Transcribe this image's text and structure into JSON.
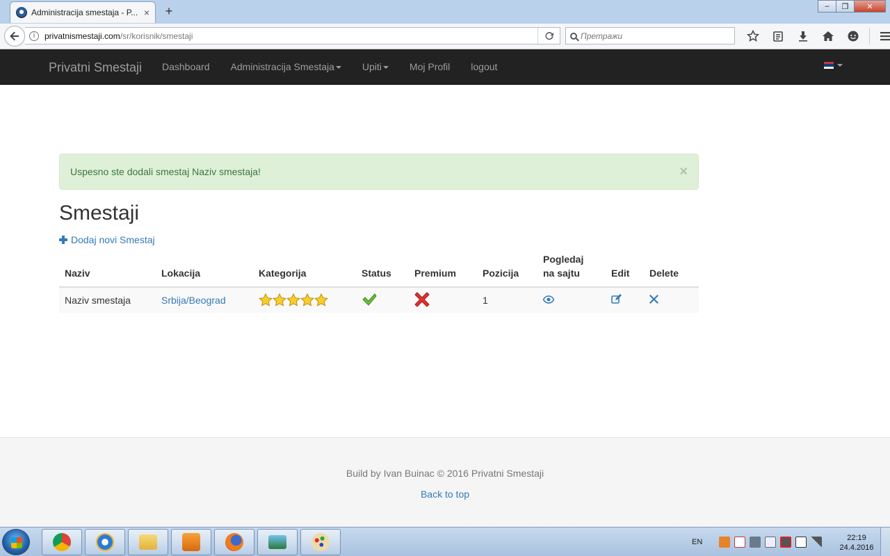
{
  "browser": {
    "tab_title": "Administracija smestaja - P...",
    "tab_close": "×",
    "new_tab": "+",
    "url_host": "privatnismestaji.com",
    "url_path": "/sr/korisnik/smestaji",
    "search_placeholder": "Претражи",
    "window_controls": {
      "minimize": "–",
      "maximize": "❐",
      "close": "✕"
    }
  },
  "site_nav": {
    "brand": "Privatni Smestaji",
    "links": [
      {
        "label": "Dashboard",
        "dropdown": false
      },
      {
        "label": "Administracija Smestaja",
        "dropdown": true
      },
      {
        "label": "Upiti",
        "dropdown": true
      },
      {
        "label": "Moj Profil",
        "dropdown": false
      },
      {
        "label": "logout",
        "dropdown": false
      }
    ],
    "flag_colors": [
      "#c6363c",
      "#0c4076",
      "#ffffff"
    ]
  },
  "alert": {
    "message": "Uspesno ste dodali smestaj Naziv smestaja!",
    "close": "×",
    "colors": {
      "bg": "#dff0d8",
      "text": "#3c763d"
    }
  },
  "main": {
    "title": "Smestaji",
    "add_link": "Dodaj novi Smestaj",
    "table": {
      "headers": {
        "naziv": "Naziv",
        "lokacija": "Lokacija",
        "kategorija": "Kategorija",
        "status": "Status",
        "premium": "Premium",
        "pozicija": "Pozicija",
        "pogledaj_1": "Pogledaj",
        "pogledaj_2": "na sajtu",
        "edit": "Edit",
        "delete": "Delete"
      },
      "rows": [
        {
          "naziv": "Naziv smestaja",
          "lokacija": "Srbija/Beograd",
          "kategorija_stars": 5,
          "status": "check-icon",
          "premium": "x-icon",
          "pozicija": "1",
          "pogledaj": "eye-icon",
          "edit": "edit-icon",
          "delete": "remove-icon"
        }
      ]
    }
  },
  "footer": {
    "credit": "Build by Ivan Buinac © 2016 Privatni Smestaji",
    "back_to_top": "Back to top"
  },
  "taskbar": {
    "language": "EN",
    "time": "22:19",
    "date": "24.4.2016"
  },
  "colors": {
    "link": "#337ab7",
    "navbar_bg": "#222222",
    "navbar_text": "#9d9d9d"
  }
}
